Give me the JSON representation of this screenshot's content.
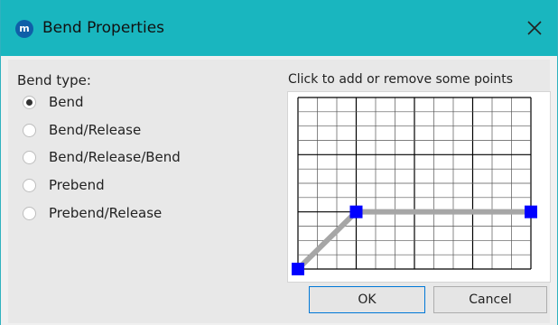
{
  "window": {
    "title": "Bend Properties",
    "app_icon_text": "m",
    "close_glyph": "✕"
  },
  "bend_type": {
    "label": "Bend type:",
    "options": [
      {
        "label": "Bend",
        "checked": true
      },
      {
        "label": "Bend/Release",
        "checked": false
      },
      {
        "label": "Bend/Release/Bend",
        "checked": false
      },
      {
        "label": "Prebend",
        "checked": false
      },
      {
        "label": "Prebend/Release",
        "checked": false
      }
    ]
  },
  "graph": {
    "title": "Click to add or remove some points",
    "columns": 12,
    "rows": 12,
    "points": [
      {
        "col": 0,
        "row": 12
      },
      {
        "col": 3,
        "row": 8
      },
      {
        "col": 12,
        "row": 8
      }
    ],
    "line_color": "#a6a6a6",
    "point_color": "#0000ff"
  },
  "buttons": {
    "ok": "OK",
    "cancel": "Cancel"
  }
}
